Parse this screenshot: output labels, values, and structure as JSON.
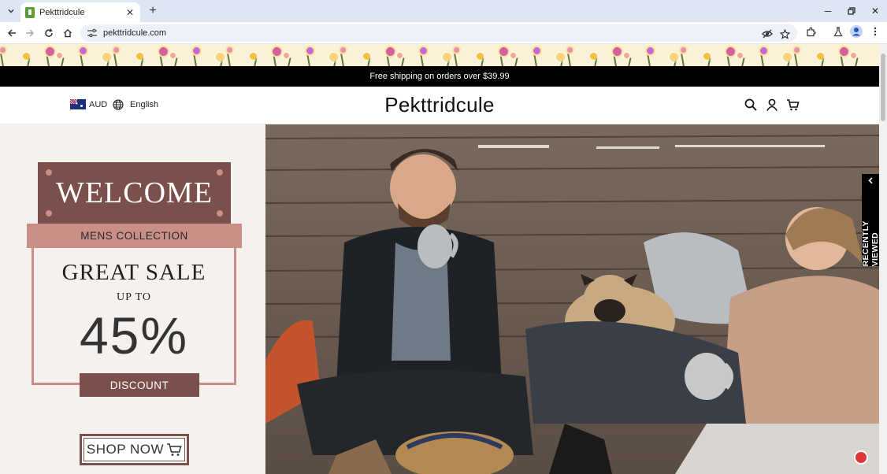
{
  "browser": {
    "tab_title": "Pekttridcule",
    "url": "pekttridcule.com"
  },
  "announcement": "Free shipping on orders over $39.99",
  "header": {
    "currency": "AUD",
    "language": "English",
    "logo": "Pekttridcule"
  },
  "promo": {
    "welcome": "WELCOME",
    "collection": "MENS COLLECTION",
    "headline": "GREAT SALE",
    "up_to": "UP TO",
    "percent": "45%",
    "discount": "DISCOUNT",
    "cta": "SHOP NOW"
  },
  "side_widget": {
    "label": "RECENTLY VIEWED"
  },
  "colors": {
    "accent_dark": "#7b4f4b",
    "accent_light": "#c98e85",
    "panel_bg": "#f5f1ee",
    "announce_bg": "#000000"
  },
  "icons": {
    "search": "search-icon",
    "account": "user-icon",
    "cart": "cart-icon",
    "language": "globe-icon"
  }
}
